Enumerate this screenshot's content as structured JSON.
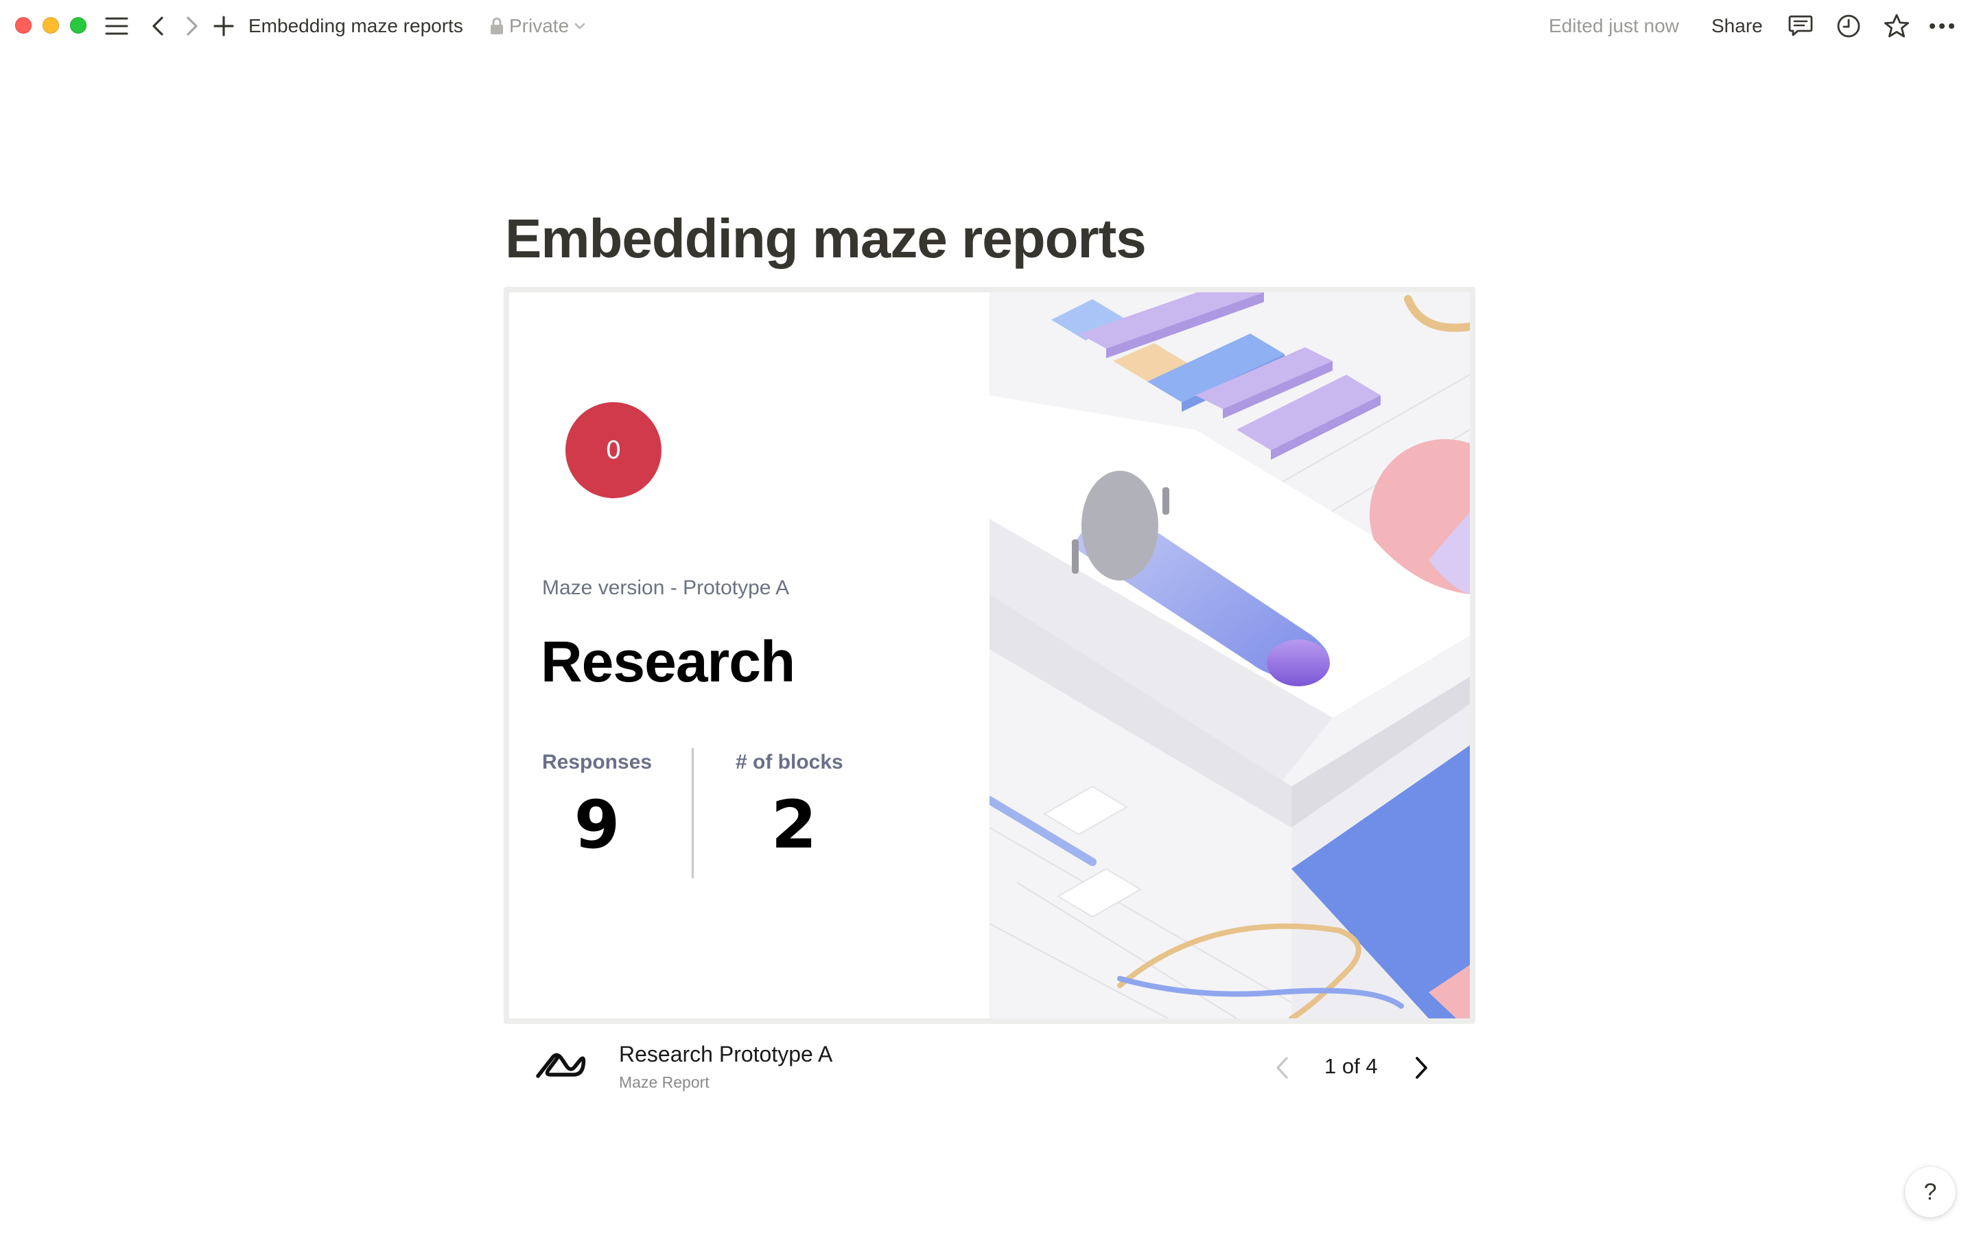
{
  "window": {
    "breadcrumb": "Embedding maze reports",
    "privacy": "Private",
    "edited_status": "Edited just now",
    "share_label": "Share",
    "icons": [
      "menu-icon",
      "back-icon",
      "forward-icon",
      "add-icon",
      "lock-icon",
      "chevron-down-icon",
      "comment-icon",
      "history-icon",
      "star-icon",
      "more-icon"
    ]
  },
  "page": {
    "title": "Embedding maze reports"
  },
  "embed": {
    "score": "0",
    "score_color": "#d03a4a",
    "version": "Maze version - Prototype A",
    "title": "Research",
    "stats": [
      {
        "label": "Responses",
        "value": "9"
      },
      {
        "label": "# of blocks",
        "value": "2"
      }
    ],
    "illustration_colors": [
      "#c9b7f0",
      "#a9c4f7",
      "#f4c9a6",
      "#f3b5b9",
      "#6f8ee8",
      "#e7ad6a"
    ]
  },
  "footer": {
    "title": "Research Prototype A",
    "subtitle": "Maze Report",
    "pager": "1 of 4"
  },
  "help": {
    "label": "?"
  }
}
